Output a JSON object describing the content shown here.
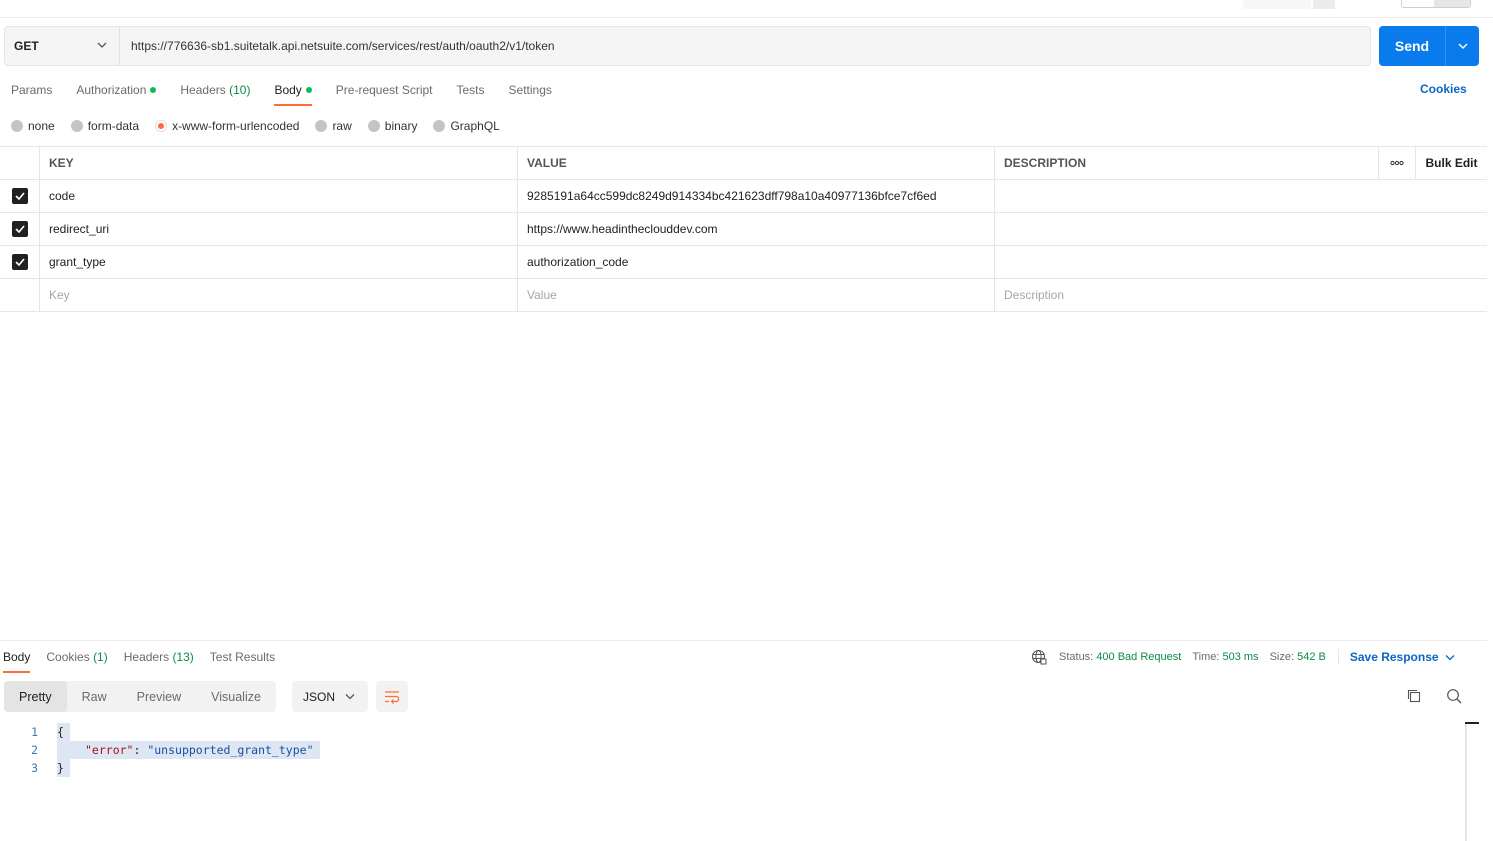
{
  "request": {
    "method": "GET",
    "url": "https://776636-sb1.suitetalk.api.netsuite.com/services/rest/auth/oauth2/v1/token",
    "send_label": "Send"
  },
  "request_tabs": [
    {
      "label": "Params"
    },
    {
      "label": "Authorization"
    },
    {
      "label": "Headers",
      "count": "(10)"
    },
    {
      "label": "Body"
    },
    {
      "label": "Pre-request Script"
    },
    {
      "label": "Tests"
    },
    {
      "label": "Settings"
    }
  ],
  "cookies_label": "Cookies",
  "body_types": [
    "none",
    "form-data",
    "x-www-form-urlencoded",
    "raw",
    "binary",
    "GraphQL"
  ],
  "body_type_selected": "x-www-form-urlencoded",
  "table": {
    "headers": {
      "key": "KEY",
      "value": "VALUE",
      "description": "DESCRIPTION",
      "bulk_edit": "Bulk Edit"
    },
    "rows": [
      {
        "key": "code",
        "value": "9285191a64cc599dc8249d914334bc421623dff798a10a40977136bfce7cf6ed",
        "description": "",
        "checked": true
      },
      {
        "key": "redirect_uri",
        "value": "https://www.headintheclouddev.com",
        "description": "",
        "checked": true
      },
      {
        "key": "grant_type",
        "value": "authorization_code",
        "description": "",
        "checked": true
      }
    ],
    "placeholders": {
      "key": "Key",
      "value": "Value",
      "description": "Description"
    }
  },
  "response_tabs": [
    {
      "label": "Body"
    },
    {
      "label": "Cookies",
      "count": "(1)"
    },
    {
      "label": "Headers",
      "count": "(13)"
    },
    {
      "label": "Test Results"
    }
  ],
  "response_status": {
    "status_label": "Status:",
    "status_value": "400 Bad Request",
    "time_label": "Time:",
    "time_value": "503 ms",
    "size_label": "Size:",
    "size_value": "542 B",
    "save_label": "Save Response"
  },
  "view_modes": [
    "Pretty",
    "Raw",
    "Preview",
    "Visualize"
  ],
  "format": "JSON",
  "response_lines": [
    {
      "n": "1",
      "text": "{"
    },
    {
      "n": "2",
      "key": "\"error\"",
      "sep": ": ",
      "value": "\"unsupported_grant_type\""
    },
    {
      "n": "3",
      "text": "}"
    }
  ],
  "colors": {
    "accent": "#ff6c37",
    "send": "#097bed",
    "link": "#0b66c3",
    "success": "#0cbb52"
  }
}
